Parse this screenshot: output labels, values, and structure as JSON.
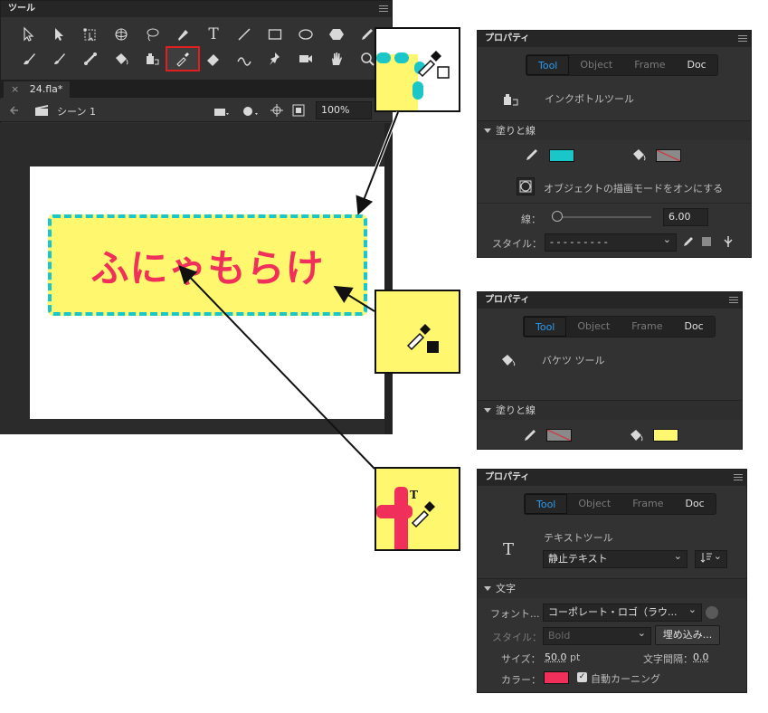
{
  "tools_panel": {
    "title": "ツール",
    "row1_icons": [
      "selection-icon",
      "subselection-icon",
      "free-transform-icon",
      "3d-rotation-icon",
      "lasso-icon",
      "pen-icon",
      "text-icon",
      "line-icon",
      "rectangle-icon",
      "oval-icon",
      "polystar-icon",
      "pencil-icon"
    ],
    "row2_icons": [
      "paint-brush-icon",
      "brush-icon",
      "bone-icon",
      "paint-bucket-icon",
      "ink-bottle-icon",
      "eyedropper-icon",
      "eraser-icon",
      "width-icon",
      "pin-icon",
      "camera-icon",
      "hand-icon",
      "zoom-icon"
    ],
    "selected_tool": "eyedropper-icon",
    "text_tool_glyph": "T"
  },
  "document": {
    "tab_close": "×",
    "tab_name": "24.fla*",
    "scene_label": "シーン 1",
    "zoom": "100%"
  },
  "stage": {
    "banner_text": "ふにゃもらけ",
    "banner_fill": "#fff86e",
    "banner_stroke": "#1ac6c8",
    "text_color": "#f0305a"
  },
  "panel_ink": {
    "title": "プロパティ",
    "tabs": [
      "Tool",
      "Object",
      "Frame",
      "Doc"
    ],
    "tool_name": "インクボトルツール",
    "section": "塗りと線",
    "stroke_color": "#1ac6c8",
    "object_draw_label": "オブジェクトの描画モードをオンにする",
    "stroke_label": "線：",
    "stroke_value": "6.00",
    "style_label": "スタイル：",
    "style_value": "- - - - - - - - -"
  },
  "panel_bucket": {
    "title": "プロパティ",
    "tabs": [
      "Tool",
      "Object",
      "Frame",
      "Doc"
    ],
    "tool_name": "バケツ ツール",
    "section": "塗りと線",
    "fill_color": "#fff86e"
  },
  "panel_text": {
    "title": "プロパティ",
    "tabs": [
      "Tool",
      "Object",
      "Frame",
      "Doc"
    ],
    "tool_name": "テキストツール",
    "tool_glyph": "T",
    "text_type": "静止テキスト",
    "section": "文字",
    "font_label": "フォント...",
    "font_value": "コーポレート・ロゴ（ラウ...",
    "style_label": "スタイル：",
    "style_value": "Bold",
    "embed_button": "埋め込み...",
    "size_label": "サイズ：",
    "size_value": "50.0",
    "size_unit": "pt",
    "spacing_label": "文字間隔：",
    "spacing_value": "0.0",
    "color_label": "カラー：",
    "text_color": "#f0305a",
    "kerning_label": "自動カーニング"
  }
}
